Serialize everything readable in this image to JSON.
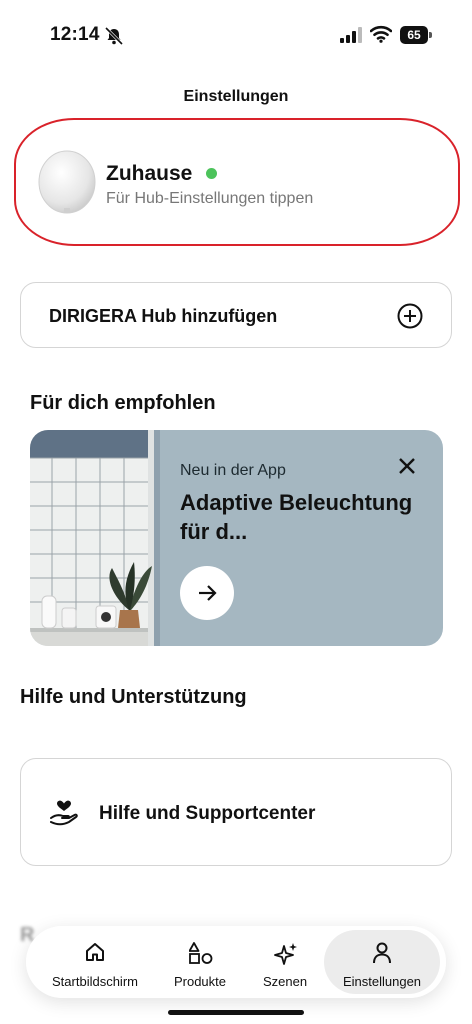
{
  "status_bar": {
    "time": "12:14",
    "battery": "65",
    "icons": [
      "bell-muted-icon",
      "signal-icon",
      "wifi-icon",
      "battery-icon"
    ]
  },
  "header": {
    "title": "Einstellungen"
  },
  "hub": {
    "name": "Zuhause",
    "subtitle": "Für Hub-Einstellungen tippen",
    "status_color": "#4cc35b",
    "highlight_color": "#d9222a"
  },
  "add_hub": {
    "label": "DIRIGERA Hub hinzufügen",
    "icon": "plus-circle-icon"
  },
  "recommended": {
    "title": "Für dich empfohlen",
    "card": {
      "kicker": "Neu in der App",
      "title": "Adaptive Beleuchtung für d...",
      "background": "#a5b7c1"
    }
  },
  "help": {
    "title": "Hilfe und Unterstützung",
    "items": [
      {
        "label": "Hilfe und Supportcenter",
        "icon": "hand-heart-icon"
      }
    ]
  },
  "partial_section": {
    "title": "R"
  },
  "tabbar": {
    "tabs": [
      {
        "label": "Startbildschirm",
        "icon": "home-icon"
      },
      {
        "label": "Produkte",
        "icon": "shapes-icon"
      },
      {
        "label": "Szenen",
        "icon": "sparkle-icon"
      },
      {
        "label": "Einstellungen",
        "icon": "person-icon",
        "active": true
      }
    ]
  }
}
